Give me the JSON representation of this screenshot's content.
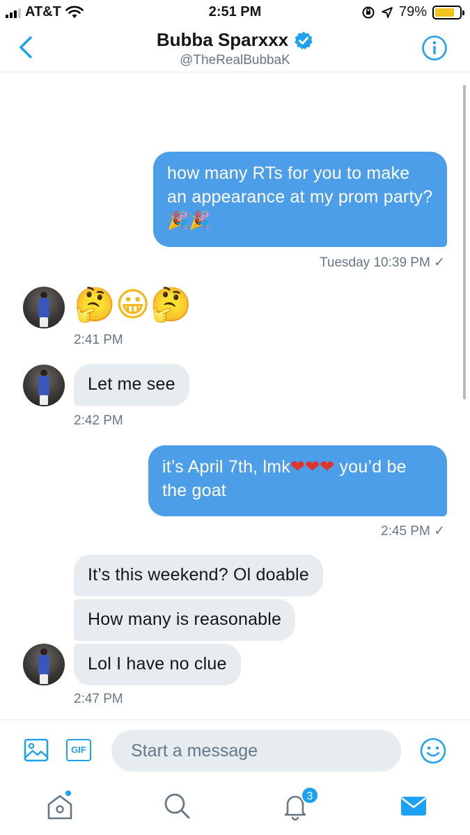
{
  "status_bar": {
    "carrier": "AT&T",
    "time": "2:51 PM",
    "battery_percent": "79%",
    "battery_level": 0.79,
    "icons": [
      "signal-icon",
      "wifi-icon",
      "rotation-lock-icon",
      "location-arrow-icon",
      "battery-icon"
    ]
  },
  "header": {
    "name": "Bubba Sparxxx",
    "handle": "@TheRealBubbaK",
    "verified": true,
    "accent": "#1da1f2"
  },
  "messages": [
    {
      "type": "sent",
      "text": "how many RTs for you to make an appearance at my prom party?🎉🎉",
      "meta": "Tuesday 10:39 PM ✓"
    },
    {
      "type": "received",
      "text": "🤔😀🤔",
      "meta": "2:41 PM"
    },
    {
      "type": "received",
      "text": "Let me see",
      "meta": "2:42 PM"
    },
    {
      "type": "sent",
      "text_before": "it’s April 7th, lmk",
      "hearts": "❤❤❤",
      "text_after": " you’d be the goat",
      "meta": "2:45 PM ✓"
    },
    {
      "type": "received",
      "text": "It’s this weekend? Ol doable"
    },
    {
      "type": "received",
      "text": "How many is reasonable"
    },
    {
      "type": "received",
      "text": "Lol I have no clue",
      "meta": "2:47 PM"
    }
  ],
  "composer": {
    "placeholder": "Start a message",
    "gif_label": "GIF"
  },
  "tabbar": {
    "notifications_badge": "3",
    "active_tab": "messages"
  },
  "colors": {
    "sent_bubble": "#4c9ee8",
    "received_bubble": "#e6ecf0",
    "meta_text": "#657786"
  }
}
